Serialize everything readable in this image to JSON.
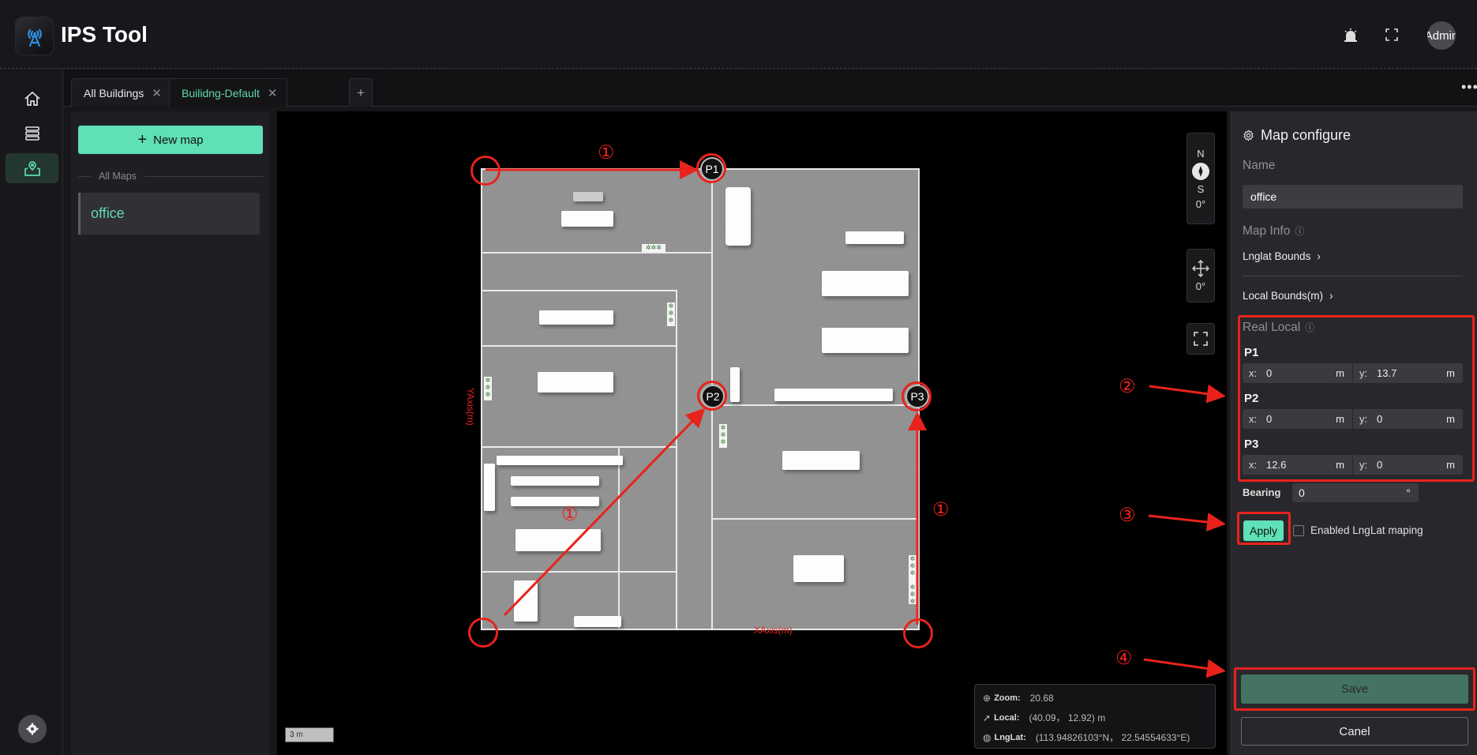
{
  "header": {
    "app_title": "IPS Tool",
    "avatar_label": "Admin",
    "icons": [
      "antenna-logo-icon",
      "alarm-icon",
      "fullscreen-icon"
    ]
  },
  "nav": {
    "items": [
      {
        "name": "home",
        "icon": "home-icon",
        "active": false
      },
      {
        "name": "buildings",
        "icon": "server-list-icon",
        "active": false
      },
      {
        "name": "maps",
        "icon": "map-pin-icon",
        "active": true
      }
    ],
    "settings_icon": "gear-icon"
  },
  "tabs": {
    "items": [
      {
        "label": "All Buildings",
        "active": false
      },
      {
        "label": "Builidng-Default",
        "active": true
      }
    ],
    "add_label": "+",
    "more_label": "•••"
  },
  "maplist": {
    "new_map_label": "New map",
    "section_label": "All Maps",
    "items": [
      {
        "label": "office",
        "selected": true
      }
    ]
  },
  "map": {
    "markers": [
      "P1",
      "P2",
      "P3"
    ],
    "x_axis_label": "XAxis(m)",
    "y_axis_label": "YAxis(m)",
    "compass": {
      "north": "N",
      "south": "S",
      "bearing": "0°"
    },
    "pan_rotation": "0°",
    "scale_label": "3 m",
    "info": {
      "zoom_label": "Zoom:",
      "zoom_value": "20.68",
      "local_label": "Local:",
      "local_value": "(40.09， 12.92)  m",
      "lnglat_label": "LngLat:",
      "lnglat_value": "(113.94826103°N， 22.54554633°E)"
    },
    "annotations": [
      "①",
      "①",
      "①",
      "②",
      "③",
      "④"
    ]
  },
  "config": {
    "title": "Map configure",
    "name_label": "Name",
    "name_value": "office",
    "map_info_label": "Map Info",
    "lnglat_bounds_label": "Lnglat Bounds",
    "local_bounds_label": "Local Bounds(m)",
    "real_local_label": "Real Local",
    "points": [
      {
        "label": "P1",
        "x": "0",
        "y": "13.7"
      },
      {
        "label": "P2",
        "x": "0",
        "y": "0"
      },
      {
        "label": "P3",
        "x": "12.6",
        "y": "0"
      }
    ],
    "x_prefix": "x:",
    "y_prefix": "y:",
    "unit": "m",
    "bearing_label": "Bearing",
    "bearing_value": "0",
    "bearing_unit": "°",
    "apply_label": "Apply",
    "enable_lnglat_label": "Enabled LngLat maping",
    "enable_lnglat_checked": false,
    "save_label": "Save",
    "cancel_label": "Canel"
  },
  "colors": {
    "accent": "#5fe0b7",
    "accent_text": "#5fd9ae",
    "annotation_red": "#e8231c",
    "save_disabled": "#447362"
  }
}
